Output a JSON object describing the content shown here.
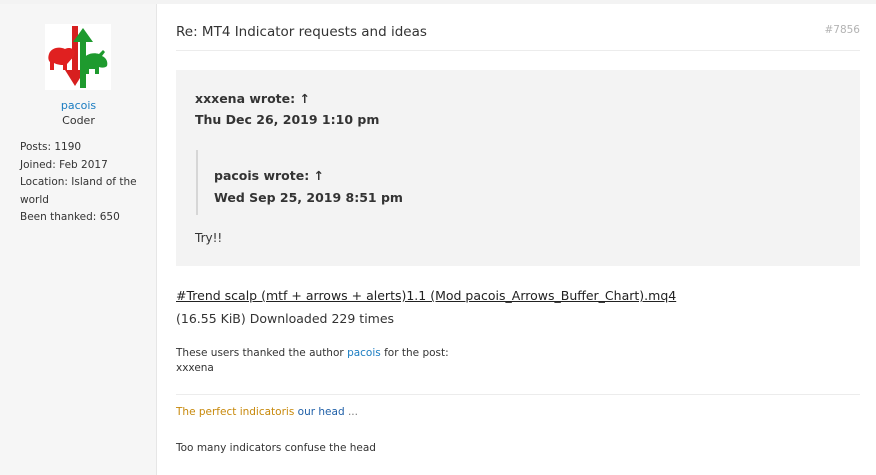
{
  "profile": {
    "username": "pacois",
    "rank": "Coder",
    "stats": {
      "posts_label": "Posts:",
      "posts_value": "1190",
      "joined_label": "Joined:",
      "joined_value": "Feb 2017",
      "location_label": "Location:",
      "location_value": "Island of the world",
      "thanked_label": "Been thanked:",
      "thanked_value": "650"
    },
    "avatar_icon": "bull-bear-arrows-icon"
  },
  "post": {
    "title": "Re: MT4 Indicator requests and ideas",
    "number": "#7856",
    "quote": {
      "author": "xxxena wrote: ↑",
      "date": "Thu Dec 26, 2019 1:10 pm",
      "nested": {
        "author": "pacois wrote: ↑",
        "date": "Wed Sep 25, 2019 8:51 pm"
      },
      "text": "Try!!"
    },
    "attachment": {
      "filename": "#Trend scalp (mtf + arrows + alerts)1.1 (Mod pacois_Arrows_Buffer_Chart).mq4",
      "info": "(16.55 KiB) Downloaded 229 times"
    },
    "thanks": {
      "prefix": "These users thanked the author",
      "author": "pacois",
      "suffix": "for the post:",
      "users": "xxxena"
    },
    "signature": {
      "line1_part1": "The perfect indicatoris",
      "line1_part2": "our head",
      "line1_part3": "...",
      "line2": "Too many indicators confuse the head"
    }
  },
  "colors": {
    "link": "#1a7cc1",
    "signature_orange": "#c7880a",
    "signature_blue": "#2060a8",
    "sidebar_bg": "#f6f6f6",
    "quote_bg": "#f3f3f3"
  }
}
